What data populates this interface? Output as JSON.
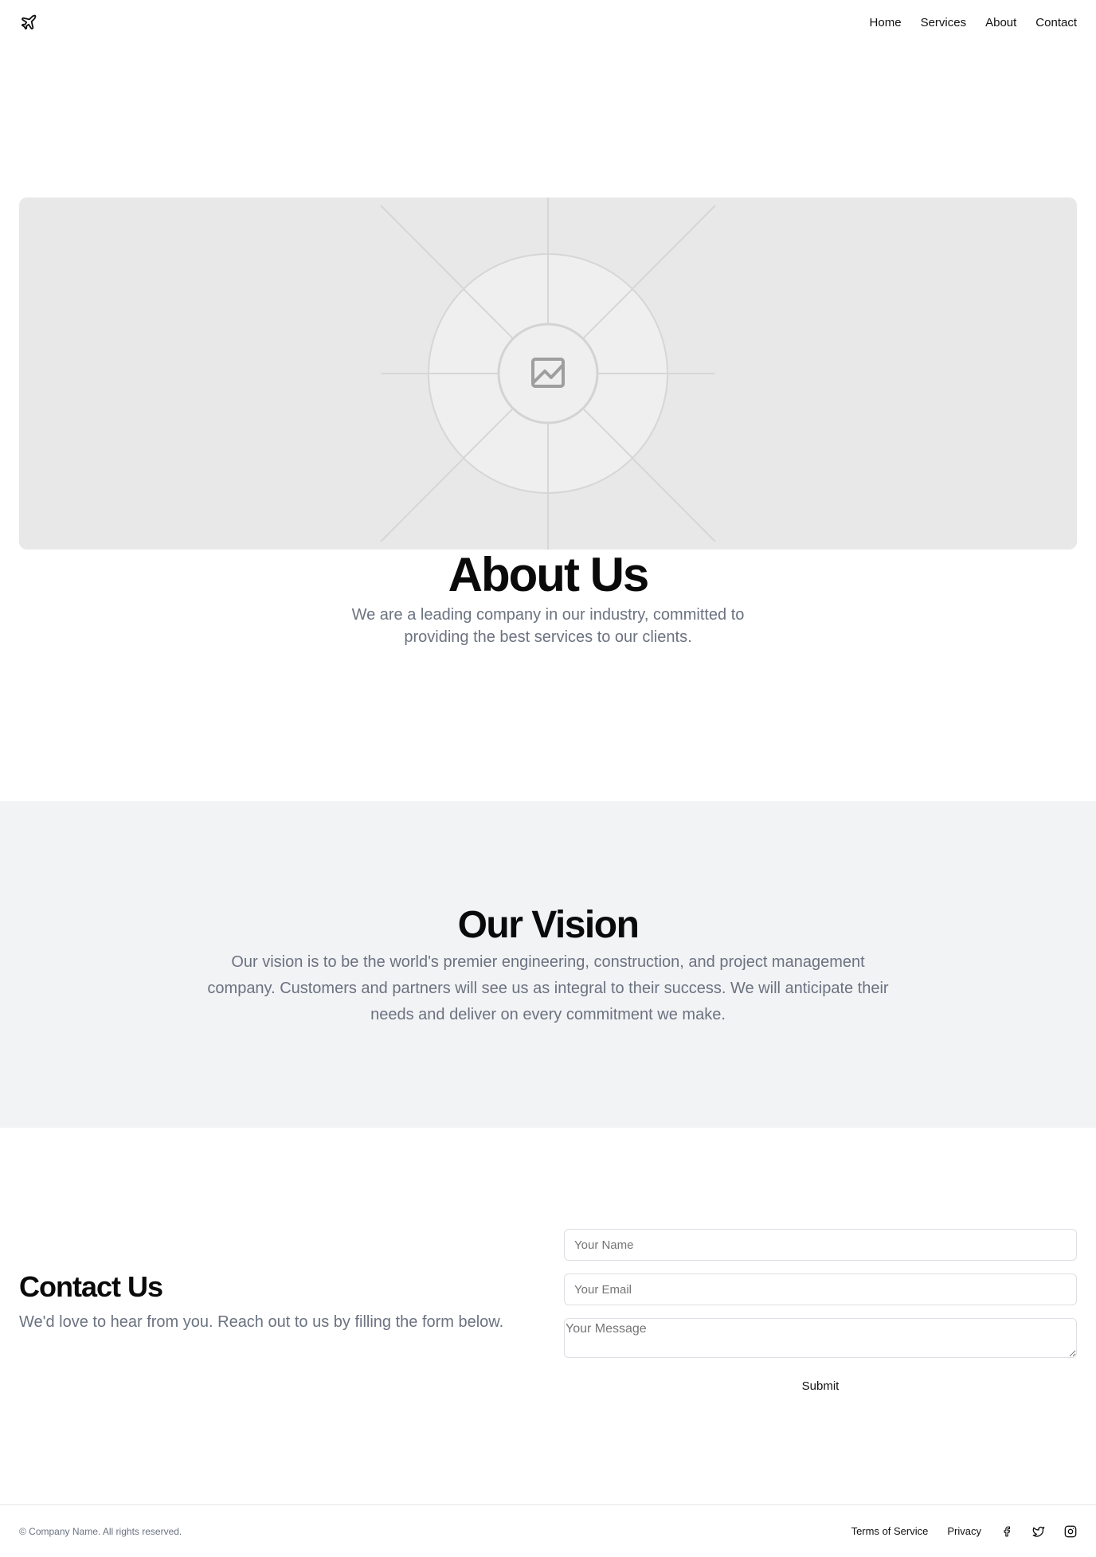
{
  "nav": {
    "logo": "plane-icon",
    "links": [
      "Home",
      "Services",
      "About",
      "Contact"
    ]
  },
  "hero": {
    "image": "image-placeholder-icon"
  },
  "about": {
    "title": "About Us",
    "text": "We are a leading company in our industry, committed to providing the best services to our clients."
  },
  "vision": {
    "title": "Our Vision",
    "text": "Our vision is to be the world's premier engineering, construction, and project management company. Customers and partners will see us as integral to their success. We will anticipate their needs and deliver on every commitment we make."
  },
  "contact": {
    "title": "Contact Us",
    "text": "We'd love to hear from you. Reach out to us by filling the form below.",
    "name_placeholder": "Your Name",
    "email_placeholder": "Your Email",
    "message_placeholder": "Your Message",
    "submit_label": "Submit"
  },
  "footer": {
    "copyright": "© Company Name. All rights reserved.",
    "links": [
      "Terms of Service",
      "Privacy"
    ],
    "social": [
      "facebook-icon",
      "twitter-icon",
      "instagram-icon"
    ]
  },
  "colors": {
    "muted_text": "#6b7280",
    "placeholder_bg": "#e8e8e8",
    "vision_bg": "#f2f3f5"
  }
}
